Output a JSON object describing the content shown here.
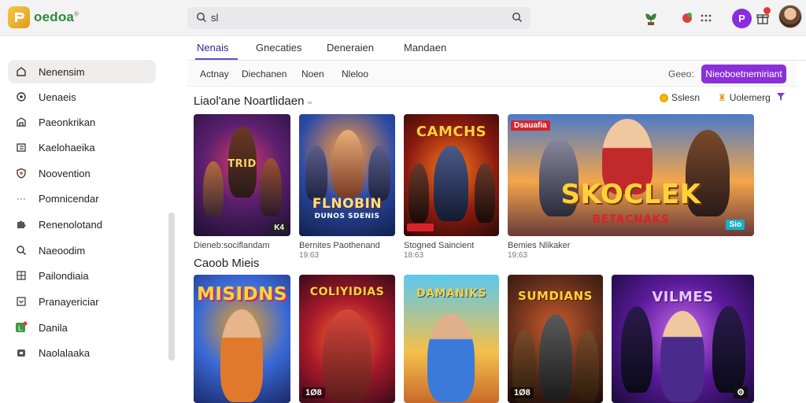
{
  "app": {
    "name": "oedoa",
    "name_mark": "®"
  },
  "search": {
    "value": "sl"
  },
  "tabs": [
    "Nenais",
    "Gnecaties",
    "Deneraien",
    "Mandaen"
  ],
  "sidebar": {
    "items": [
      {
        "label": "Nenensim",
        "icon": "home-icon"
      },
      {
        "label": "Uenaeis",
        "icon": "settings-icon"
      },
      {
        "label": "Paeonkrikan",
        "icon": "store-icon"
      },
      {
        "label": "Kaelohaeika",
        "icon": "library-icon"
      },
      {
        "label": "Noovention",
        "icon": "shield-icon"
      },
      {
        "label": "Pomnicendar",
        "icon": "more-icon"
      },
      {
        "label": "Renenolotand",
        "icon": "puzzle-icon"
      },
      {
        "label": "Naeoodim",
        "icon": "search-icon"
      },
      {
        "label": "Pailondiaia",
        "icon": "grid-icon"
      },
      {
        "label": "Pranayericiar",
        "icon": "dropdown-icon"
      },
      {
        "label": "Danila",
        "icon": "app-icon"
      },
      {
        "label": "Naolalaaka",
        "icon": "gamepad-icon"
      }
    ]
  },
  "filters": {
    "items": [
      "Actnay",
      "Diechanen",
      "Noen",
      "Nleloo"
    ],
    "sort_label": "Geeo:",
    "primary_button": "Nieoboetnemiriant"
  },
  "section1": {
    "title": "Liaol'ane Noartlidaen",
    "title_suffix": "∞",
    "chips": [
      "Sslesn",
      "Uolemerg"
    ],
    "cards": [
      {
        "art_title": "TRID",
        "badge": "K4",
        "caption": "Dieneb:sociflandam",
        "sub": ""
      },
      {
        "art_title": "FLNOBIN",
        "art_sub": "DUNOS SDENIS",
        "caption": "Bernites Paothenand",
        "sub": "19:63"
      },
      {
        "art_title": "CAMCHS",
        "caption": "Stogned Saincient",
        "sub": "18:63"
      },
      {
        "art_title": "SKOCLEK",
        "art_sub": "BETACNAKS",
        "tag": "Dsauafia",
        "badge": "Sio",
        "caption": "Bemies Nlikaker",
        "sub": "19:63"
      }
    ]
  },
  "section2": {
    "title": "Caoob Mieis",
    "cards": [
      {
        "art_title": "MISIDNS",
        "badge": ""
      },
      {
        "art_title": "COLIYIDIAS",
        "badge": "1Ø8"
      },
      {
        "art_title": "DAMANIKS",
        "badge": ""
      },
      {
        "art_title": "SUMDIANS",
        "badge": "1Ø8"
      },
      {
        "art_title": "VILMES",
        "badge": "⚙"
      }
    ]
  },
  "colors": {
    "accent": "#8b2fd8",
    "tab_underline": "#5a4bd6",
    "logo": "#2f8a3a"
  }
}
